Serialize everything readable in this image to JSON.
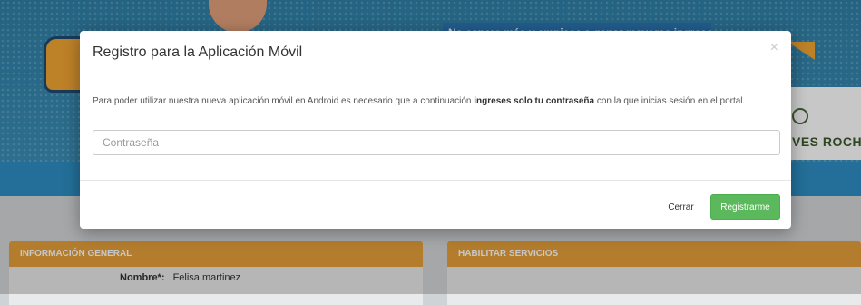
{
  "background": {
    "banner_text": "No espere más y empiece a ganar mayores ingresos",
    "brand_text": "VES ROCHE",
    "panels": {
      "general_info": "INFORMACIÓN GENERAL",
      "enable_services": "HABILITAR SERVICIOS"
    },
    "fields": {
      "name_label": "Nombre*:",
      "name_value": "Felisa martinez"
    }
  },
  "modal": {
    "title": "Registro para la Aplicación Móvil",
    "close_symbol": "×",
    "message_prefix": "Para poder utilizar nuestra nueva aplicación móvil en Android es necesario que a continuación ",
    "message_bold": "ingreses solo tu contraseña",
    "message_suffix": " con la que inicias sesión en el portal.",
    "password_placeholder": "Contraseña",
    "password_value": "",
    "buttons": {
      "close_label": "Cerrar",
      "register_label": "Registrarme"
    }
  },
  "colors": {
    "banner_blue": "#3b8eb7",
    "panel_orange": "#e7a03a",
    "register_green": "#5cb85c"
  }
}
